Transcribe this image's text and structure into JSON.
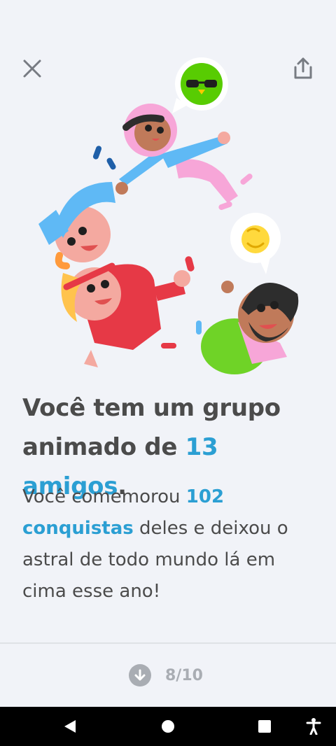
{
  "header": {
    "close_icon": "close-icon",
    "share_icon": "share-icon"
  },
  "headline": {
    "part1": "Você tem um grupo animado de ",
    "highlight": "13 amigos",
    "part2": "."
  },
  "body": {
    "part1": "Você comemorou ",
    "highlight": "102 conquistas",
    "part2": " deles e deixou o astral de todo mundo lá em cima esse ano!"
  },
  "footer": {
    "progress_icon": "arrow-down-circle-icon",
    "progress_label": "8/10"
  },
  "navbar": {
    "back_icon": "back-triangle-icon",
    "home_icon": "home-circle-icon",
    "recents_icon": "recents-square-icon",
    "accessibility_icon": "accessibility-icon"
  },
  "colors": {
    "background": "#f1f3f8",
    "text": "#4b4b4b",
    "accent": "#2b9fd3",
    "muted": "#a9adb3"
  }
}
